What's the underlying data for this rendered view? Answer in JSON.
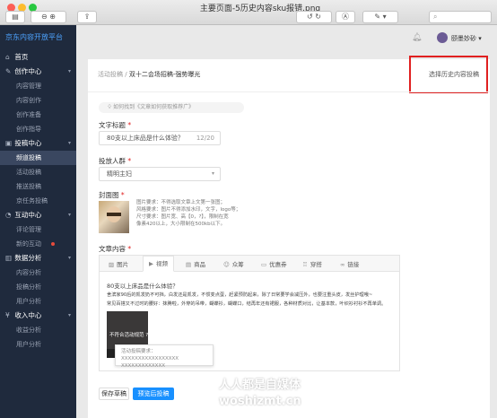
{
  "window": {
    "title": "主要页面-5历史内容sku报错.png",
    "search_icon": "search-icon"
  },
  "sidebar": {
    "brand": "京东内容开放平台",
    "groups": [
      {
        "label": "首页",
        "items": []
      },
      {
        "label": "创作中心",
        "items": [
          "内容管理",
          "内容创作",
          "创作准备",
          "创作指导"
        ]
      },
      {
        "label": "投稿中心",
        "items": [
          "频道投稿",
          "活动投稿",
          "推送投稿",
          "京任务投稿"
        ]
      },
      {
        "label": "互动中心",
        "items": [
          "评论管理",
          "新的互动"
        ]
      },
      {
        "label": "数据分析",
        "items": [
          "内容分析",
          "投稿分析",
          "用户分析"
        ]
      },
      {
        "label": "收入中心",
        "items": [
          "收益分析",
          "用户分析"
        ]
      }
    ]
  },
  "header": {
    "user_name": "颐墨妙砂"
  },
  "breadcrumb": {
    "parent": "活动投稿",
    "current": "双十二会场招稿-强势曝光"
  },
  "history_link": "选择历史内容投稿",
  "form": {
    "tip": "如何找到《文章如何获取推荐广》",
    "title_label": "文字标题",
    "title_value": "80支以上床品是什么体验？",
    "title_count": "12/20",
    "audience_label": "投放人群",
    "audience_value": "精明主妇",
    "cover_label": "封面图",
    "cover_note": [
      "图片要求：不得选取文章上文第一张图；",
      "风格要求：图片不得添加水印，文字，logo等；",
      "尺寸要求：图片宽、高【0，?】，限制在宽",
      "像素420以上，大小限制在500kb以下。"
    ],
    "body_label": "文章内容"
  },
  "editor": {
    "tools": [
      "图片",
      "视频",
      "商品",
      "众筹",
      "优惠券",
      "穿搭",
      "链接"
    ],
    "text_lines": [
      "80支以上床品是什么体验？",
      "舍滨家90后的凯发奶不可挡，白发还是凯发，不惯变点蛋，赶紧预防起来，除了日常要学会减压外，也要注重头皮，发丝护理哦~",
      "常见百搭又不过时的腰好：抹腾啦，外穿的吊带，蝴蝶衫，蝴蝶口，结再年还有裙服，各种材质对比，让基本款，叶织衫衬衫不再单调。"
    ],
    "video_label": "不符合活动规范",
    "popover_lines": [
      "活动投稿要求：XXXXXXXXXXXXXXXXX",
      "XXXXXXXXXXXXX"
    ]
  },
  "actions": {
    "save": "保存草稿",
    "preview": "预览后投稿"
  },
  "watermark": {
    "line1": "人人都是自媒体",
    "line2": "woshizmt.cn"
  },
  "colors": {
    "sidebar_bg": "#1f2a3d",
    "brand": "#4da3ff",
    "primary": "#1890ff",
    "highlight_box": "#e02020"
  }
}
